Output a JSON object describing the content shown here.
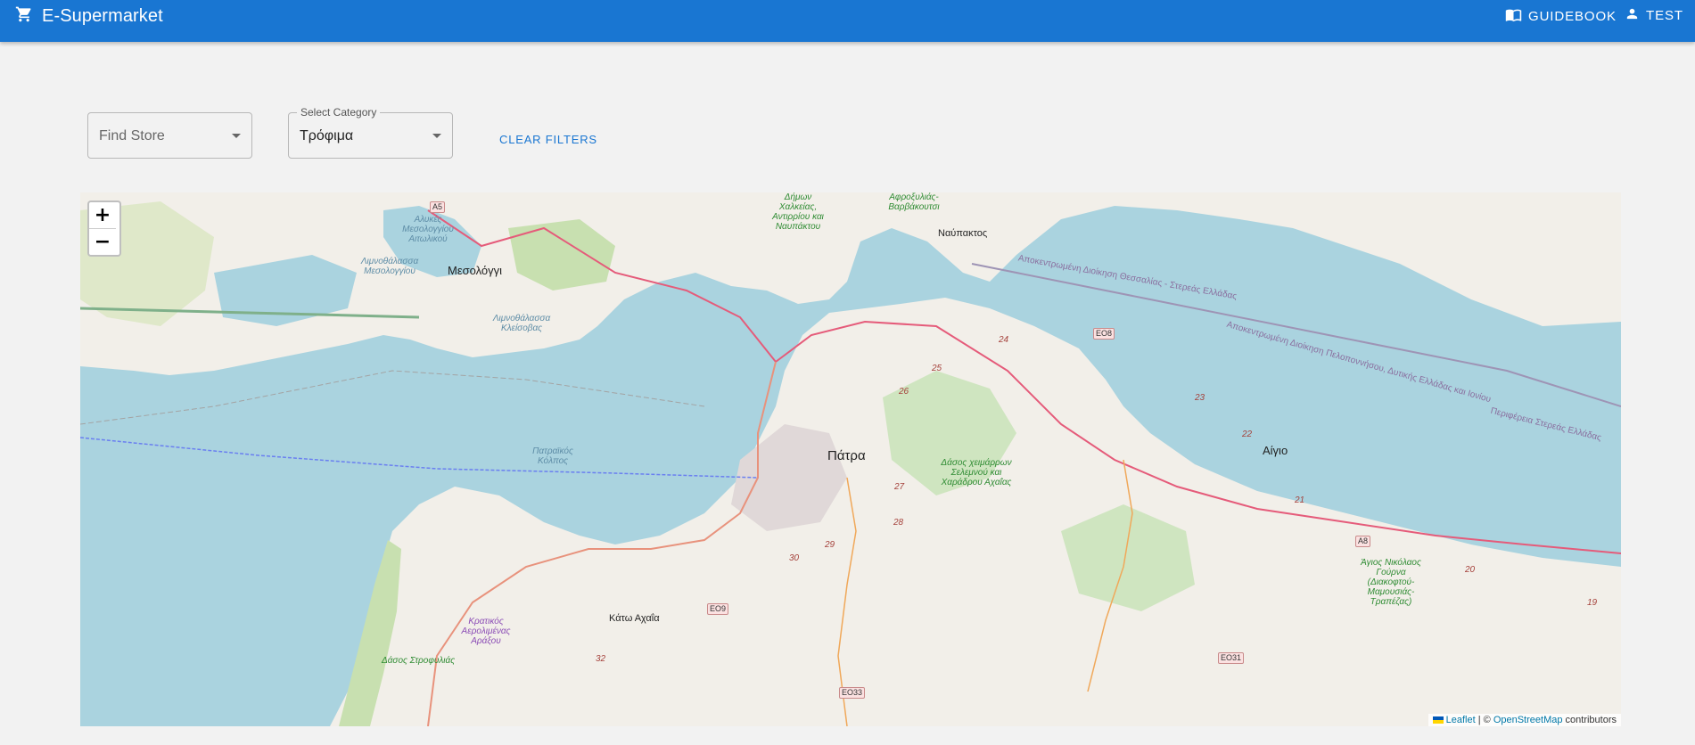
{
  "appbar": {
    "title": "E-Supermarket",
    "cart_icon": "shopping-cart-icon",
    "guidebook_label": "GUIDEBOOK",
    "guidebook_icon": "book-icon",
    "user_label": "TEST",
    "user_icon": "person-icon"
  },
  "filters": {
    "store_placeholder": "Find Store",
    "category_label": "Select Category",
    "category_value": "Τρόφιμα",
    "clear_label": "CLEAR FILTERS"
  },
  "map": {
    "zoom_in": "+",
    "zoom_out": "−",
    "attribution": {
      "leaflet": "Leaflet",
      "separator": " | © ",
      "osm": "OpenStreetMap",
      "suffix": " contributors"
    },
    "labels": {
      "patra": "Πάτρα",
      "mesologgi": "Μεσολόγγι",
      "nafpaktos": "Ναύπακτος",
      "aigio": "Αίγιο",
      "kato_achaia": "Κάτω Αχαΐα",
      "lagoon_mesologgi": "Λιμνοθάλασσα Μεσολογγίου",
      "lagoon_kleisova": "Λιμνοθάλασσα Κλείσοβας",
      "alykes": "Αλυκές Μεσολογγίου Αιτωλικού",
      "patraikos": "Πατραϊκός Κόλπος",
      "forest_cheimarron": "Δάσος χειμάρρων Σελεμνού και Χαράδρου Αχαΐας",
      "forest_strofylia": "Δάσος Στροφυλιάς",
      "airport": "Κρατικός Αερολιμένας Αράξου",
      "dimos": "Δήμων Χαλκείας, Αντιρρίου και Ναυπάκτου",
      "afroxylias": "Αφροξυλιάς-Βαρβάκουτσι",
      "agios_nikolaos": "Άγιος Νικόλαος Γούρνα (Διακοφτού-Μαμουσιάς-Τραπέζας)",
      "admin_thessalias": "Αποκεντρωμένη Διοίκηση Θεσσαλίας - Στερεάς Ελλάδας",
      "admin_peloponnisou": "Αποκεντρωμένη Διοίκηση Πελοποννήσου, Δυτικής Ελλάδας και Ιονίου",
      "perifereia_sterea": "Περιφέρεια Στερεάς Ελλάδας"
    },
    "road_shields": [
      "A5",
      "EO8",
      "EO9",
      "EO33",
      "EO31",
      "A8"
    ],
    "road_numbers": [
      "24",
      "25",
      "26",
      "27",
      "28",
      "29",
      "30",
      "32",
      "23",
      "22",
      "21",
      "20",
      "19"
    ]
  }
}
